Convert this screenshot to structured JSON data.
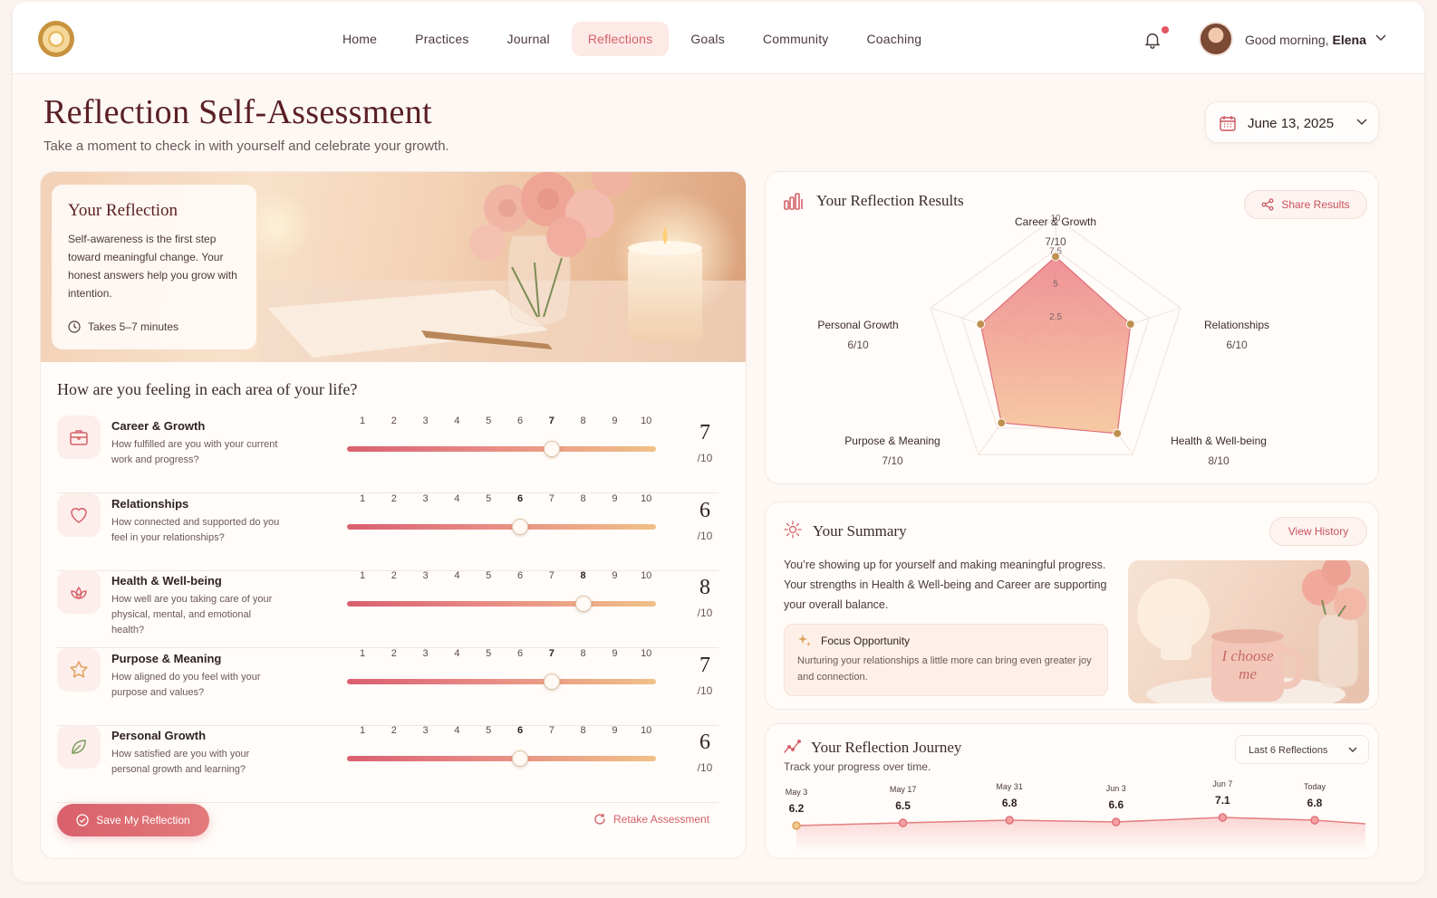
{
  "nav": {
    "links": [
      "Home",
      "Practices",
      "Journal",
      "Reflections",
      "Goals",
      "Community",
      "Coaching"
    ],
    "active": "Reflections",
    "greeting_prefix": "Good morning,",
    "user_name": "Elena"
  },
  "header": {
    "title": "Reflection Self-Assessment",
    "subtitle": "Take a moment to check in with yourself and celebrate your growth.",
    "date": "June 13, 2025"
  },
  "hero": {
    "title": "Your Reflection",
    "text": "Self-awareness is the first step toward meaningful change. Your honest answers help you grow with intention.",
    "time": "Takes 5–7 minutes"
  },
  "assessment": {
    "question": "How are you feeling in each area of your life?",
    "scale": [
      "1",
      "2",
      "3",
      "4",
      "5",
      "6",
      "7",
      "8",
      "9",
      "10"
    ],
    "out_of": "/10",
    "areas": [
      {
        "title": "Career & Growth",
        "desc": "How fulfilled are you with your current work and progress?",
        "score": 7,
        "icon": "briefcase-icon"
      },
      {
        "title": "Relationships",
        "desc": "How connected and supported do you feel in your relationships?",
        "score": 6,
        "icon": "heart-icon"
      },
      {
        "title": "Health & Well-being",
        "desc": "How well are you taking care of your physical, mental, and emotional health?",
        "score": 8,
        "icon": "lotus-icon"
      },
      {
        "title": "Purpose & Meaning",
        "desc": "How aligned do you feel with your purpose and values?",
        "score": 7,
        "icon": "star-icon"
      },
      {
        "title": "Personal Growth",
        "desc": "How satisfied are you with your personal growth and learning?",
        "score": 6,
        "icon": "leaf-icon"
      }
    ],
    "save_label": "Save My Reflection",
    "retake_label": "Retake Assessment"
  },
  "results": {
    "title": "Your Reflection Results",
    "share_label": "Share Results",
    "ticks": [
      "10",
      "7.5",
      "5",
      "2.5"
    ],
    "labels": [
      {
        "name": "Career & Growth",
        "score": "7/10"
      },
      {
        "name": "Relationships",
        "score": "6/10"
      },
      {
        "name": "Health & Well-being",
        "score": "8/10"
      },
      {
        "name": "Purpose & Meaning",
        "score": "7/10"
      },
      {
        "name": "Personal Growth",
        "score": "6/10"
      }
    ]
  },
  "summary": {
    "title": "Your Summary",
    "history_label": "View History",
    "text": "You’re showing up for yourself and making meaningful progress. Your strengths in Health & Well-being and Career are supporting your overall balance.",
    "focus_title": "Focus Opportunity",
    "focus_text": "Nurturing your relationships a little more can bring even greater joy and connection.",
    "mug_text": "I choose me"
  },
  "journey": {
    "title": "Your Reflection Journey",
    "subtitle": "Track your progress over time.",
    "range_label": "Last 6 Reflections"
  },
  "chart_data": {
    "type": "line",
    "x": [
      "May 3",
      "May 17",
      "May 31",
      "Jun 3",
      "Jun 7",
      "Today"
    ],
    "values": [
      6.2,
      6.5,
      6.8,
      6.6,
      7.1,
      6.8
    ],
    "value_labels": [
      "6.2",
      "6.5",
      "6.8",
      "6.6",
      "7.1",
      "6.8"
    ],
    "ylim": [
      5,
      8
    ],
    "grid": false
  },
  "radar_data": {
    "type": "radar",
    "axes": [
      "Career & Growth",
      "Relationships",
      "Health & Well-being",
      "Purpose & Meaning",
      "Personal Growth"
    ],
    "values": [
      7,
      6,
      8,
      7,
      6
    ],
    "max": 10
  },
  "colors": {
    "accent": "#d4616a",
    "title": "#5a1f24",
    "marker": "#c09050"
  }
}
